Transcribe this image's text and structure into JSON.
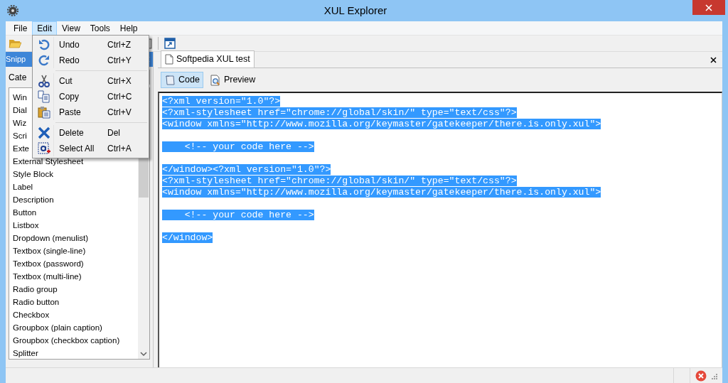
{
  "window": {
    "title": "XUL Explorer"
  },
  "menu_bar": [
    {
      "label": "File",
      "selected": false
    },
    {
      "label": "Edit",
      "selected": true
    },
    {
      "label": "View",
      "selected": false
    },
    {
      "label": "Tools",
      "selected": false
    },
    {
      "label": "Help",
      "selected": false
    }
  ],
  "edit_menu": {
    "groups": [
      [
        {
          "kind": "undo",
          "label": "Undo",
          "shortcut": "Ctrl+Z"
        },
        {
          "kind": "redo",
          "label": "Redo",
          "shortcut": "Ctrl+Y"
        }
      ],
      [
        {
          "kind": "cut",
          "label": "Cut",
          "shortcut": "Ctrl+X"
        },
        {
          "kind": "copy",
          "label": "Copy",
          "shortcut": "Ctrl+C"
        },
        {
          "kind": "paste",
          "label": "Paste",
          "shortcut": "Ctrl+V"
        }
      ],
      [
        {
          "kind": "delete",
          "label": "Delete",
          "shortcut": "Del"
        },
        {
          "kind": "selectall",
          "label": "Select All",
          "shortcut": "Ctrl+A"
        }
      ]
    ]
  },
  "snippets_panel": {
    "title": "Snipp",
    "category_label": "Cate",
    "items": [
      "Win",
      "Dial",
      "Wiz",
      "Scri",
      "Exte",
      "External Stylesheet",
      "Style Block",
      "Label",
      "Description",
      "Button",
      "Listbox",
      "Dropdown (menulist)",
      "Textbox (single-line)",
      "Textbox (password)",
      "Textbox (multi-line)",
      "Radio group",
      "Radio button",
      "Checkbox",
      "Groupbox (plain caption)",
      "Groupbox (checkbox caption)",
      "Splitter"
    ]
  },
  "editor": {
    "tabs": [
      {
        "label": "Softpedia XUL test",
        "selected": true
      }
    ],
    "view_buttons": [
      {
        "kind": "code",
        "label": "Code",
        "selected": true
      },
      {
        "kind": "preview",
        "label": "Preview",
        "selected": false
      }
    ],
    "code_lines": [
      {
        "kind": "text",
        "text": "<?xml version=\"1.0\"?>",
        "selected": true
      },
      {
        "kind": "text",
        "text": "<?xml-stylesheet href=\"chrome://global/skin/\" type=\"text/css\"?>",
        "selected": true
      },
      {
        "kind": "text",
        "text": "<window xmlns=\"http://www.mozilla.org/keymaster/gatekeeper/there.is.only.xul\">",
        "selected": true
      },
      {
        "kind": "blank"
      },
      {
        "kind": "text",
        "text": "    <!-- your code here -->",
        "selected": true
      },
      {
        "kind": "blank"
      },
      {
        "kind": "text",
        "text": "</window><?xml version=\"1.0\"?>",
        "selected": true
      },
      {
        "kind": "text",
        "text": "<?xml-stylesheet href=\"chrome://global/skin/\" type=\"text/css\"?>",
        "selected": true
      },
      {
        "kind": "text",
        "text": "<window xmlns=\"http://www.mozilla.org/keymaster/gatekeeper/there.is.only.xul\">",
        "selected": true
      },
      {
        "kind": "blank"
      },
      {
        "kind": "text",
        "text": "    <!-- your code here -->",
        "selected": true
      },
      {
        "kind": "blank"
      },
      {
        "kind": "text",
        "text": "</window>",
        "selected": true
      }
    ]
  },
  "status_bar": {
    "error": true
  }
}
